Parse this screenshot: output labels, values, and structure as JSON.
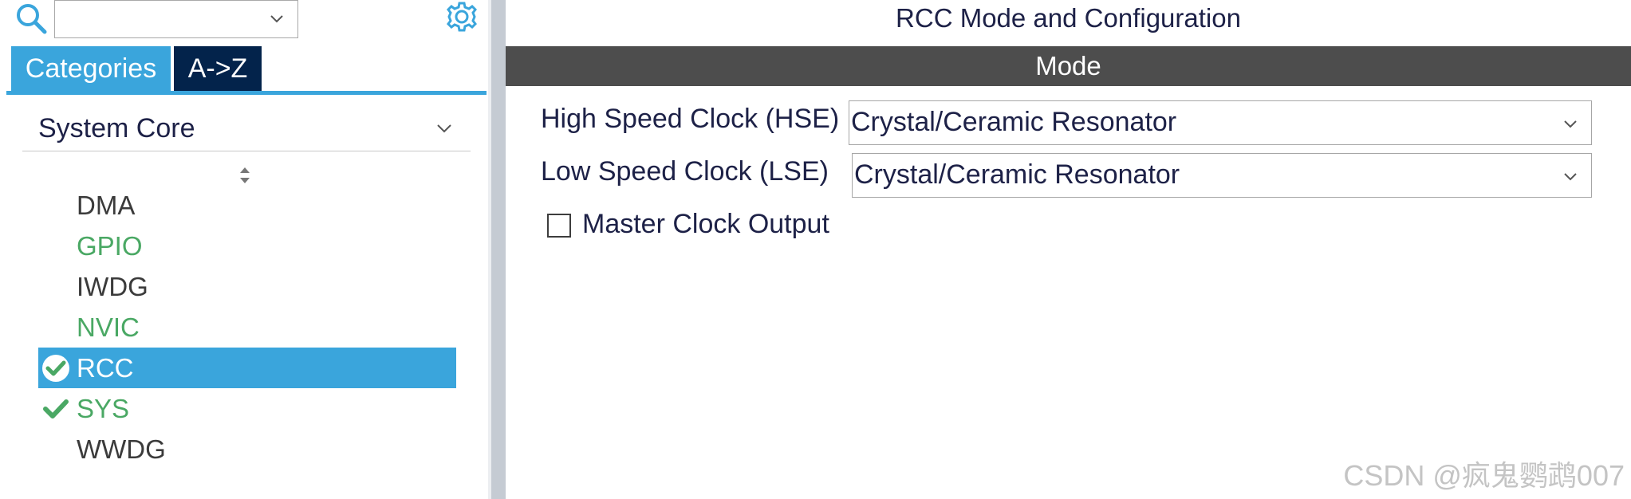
{
  "sidebar": {
    "search": {
      "value": ""
    },
    "tabs": [
      {
        "label": "Categories",
        "active": true
      },
      {
        "label": "A->Z",
        "active": false
      }
    ],
    "category": {
      "label": "System Core"
    },
    "items": [
      {
        "label": "DMA",
        "status": "none"
      },
      {
        "label": "GPIO",
        "status": "configured"
      },
      {
        "label": "IWDG",
        "status": "none"
      },
      {
        "label": "NVIC",
        "status": "configured"
      },
      {
        "label": "RCC",
        "status": "selected",
        "checked": true
      },
      {
        "label": "SYS",
        "status": "configured",
        "checked": true
      },
      {
        "label": "WWDG",
        "status": "none"
      }
    ]
  },
  "main": {
    "title": "RCC Mode and Configuration",
    "mode_header": "Mode",
    "hse": {
      "label": "High Speed Clock (HSE)",
      "value": "Crystal/Ceramic Resonator"
    },
    "lse": {
      "label": "Low Speed Clock (LSE)",
      "value": "Crystal/Ceramic Resonator"
    },
    "mco": {
      "label": "Master Clock Output",
      "checked": false
    }
  },
  "watermark": "CSDN @疯鬼鹦鹉007",
  "colors": {
    "accent": "#3aa5dc",
    "tab_dark": "#03234b",
    "green": "#4aa864",
    "mode_bar": "#4d4d4d",
    "text": "#1d2147"
  },
  "icons": [
    "search-icon",
    "chevron-down-icon",
    "gear-icon",
    "sort-icon",
    "check-circle-icon",
    "check-icon"
  ]
}
